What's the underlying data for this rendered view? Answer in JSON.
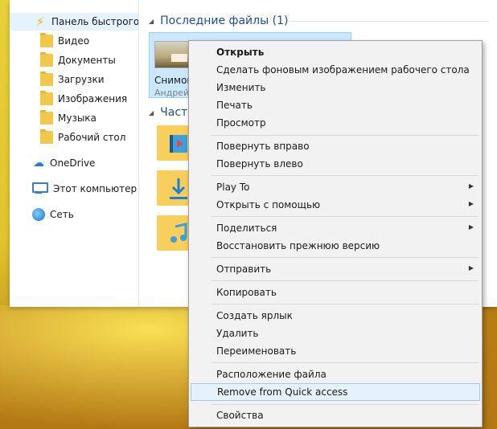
{
  "nav": {
    "items": [
      {
        "label": "Панель быстрого доступа",
        "icon": "quick-access-bolt-icon"
      },
      {
        "label": "Видео",
        "icon": "video-folder-icon",
        "pinned": true
      },
      {
        "label": "Документы",
        "icon": "documents-folder-icon",
        "pinned": true
      },
      {
        "label": "Загрузки",
        "icon": "downloads-folder-icon",
        "pinned": true
      },
      {
        "label": "Изображения",
        "icon": "pictures-folder-icon",
        "pinned": true
      },
      {
        "label": "Музыка",
        "icon": "music-folder-icon",
        "pinned": true
      },
      {
        "label": "Рабочий стол",
        "icon": "desktop-folder-icon",
        "pinned": true
      },
      {
        "label": "OneDrive",
        "icon": "onedrive-cloud-icon"
      },
      {
        "label": "Этот компьютер",
        "icon": "this-pc-icon"
      },
      {
        "label": "Сеть",
        "icon": "network-globe-icon"
      }
    ]
  },
  "content": {
    "recent_header": "Последние файлы (1)",
    "frequent_header": "Часто",
    "recent_file": {
      "name": "Снимок",
      "sub": "Андрей"
    }
  },
  "context_menu": {
    "items": [
      {
        "label": "Открыть",
        "bold": true
      },
      {
        "label": "Сделать фоновым изображением рабочего стола"
      },
      {
        "label": "Изменить"
      },
      {
        "label": "Печать"
      },
      {
        "label": "Просмотр"
      },
      {
        "separator": true
      },
      {
        "label": "Повернуть вправо"
      },
      {
        "label": "Повернуть влево"
      },
      {
        "separator": true
      },
      {
        "label": "Play To",
        "submenu": true
      },
      {
        "label": "Открыть с помощью",
        "submenu": true
      },
      {
        "separator": true
      },
      {
        "label": "Поделиться",
        "submenu": true
      },
      {
        "label": "Восстановить прежнюю версию"
      },
      {
        "separator": true
      },
      {
        "label": "Отправить",
        "submenu": true
      },
      {
        "separator": true
      },
      {
        "label": "Копировать"
      },
      {
        "separator": true
      },
      {
        "label": "Создать ярлык"
      },
      {
        "label": "Удалить"
      },
      {
        "label": "Переименовать"
      },
      {
        "separator": true
      },
      {
        "label": "Расположение файла"
      },
      {
        "label": "Remove from Quick access",
        "highlighted": true
      },
      {
        "separator": true
      },
      {
        "label": "Свойства"
      }
    ]
  },
  "colors": {
    "accent": "#1e4e8c",
    "menu_bg": "#f2f2f2",
    "hover_bg": "#e5f1fb",
    "selection_bg": "#cce8ff",
    "folder": "#f2c84b"
  }
}
